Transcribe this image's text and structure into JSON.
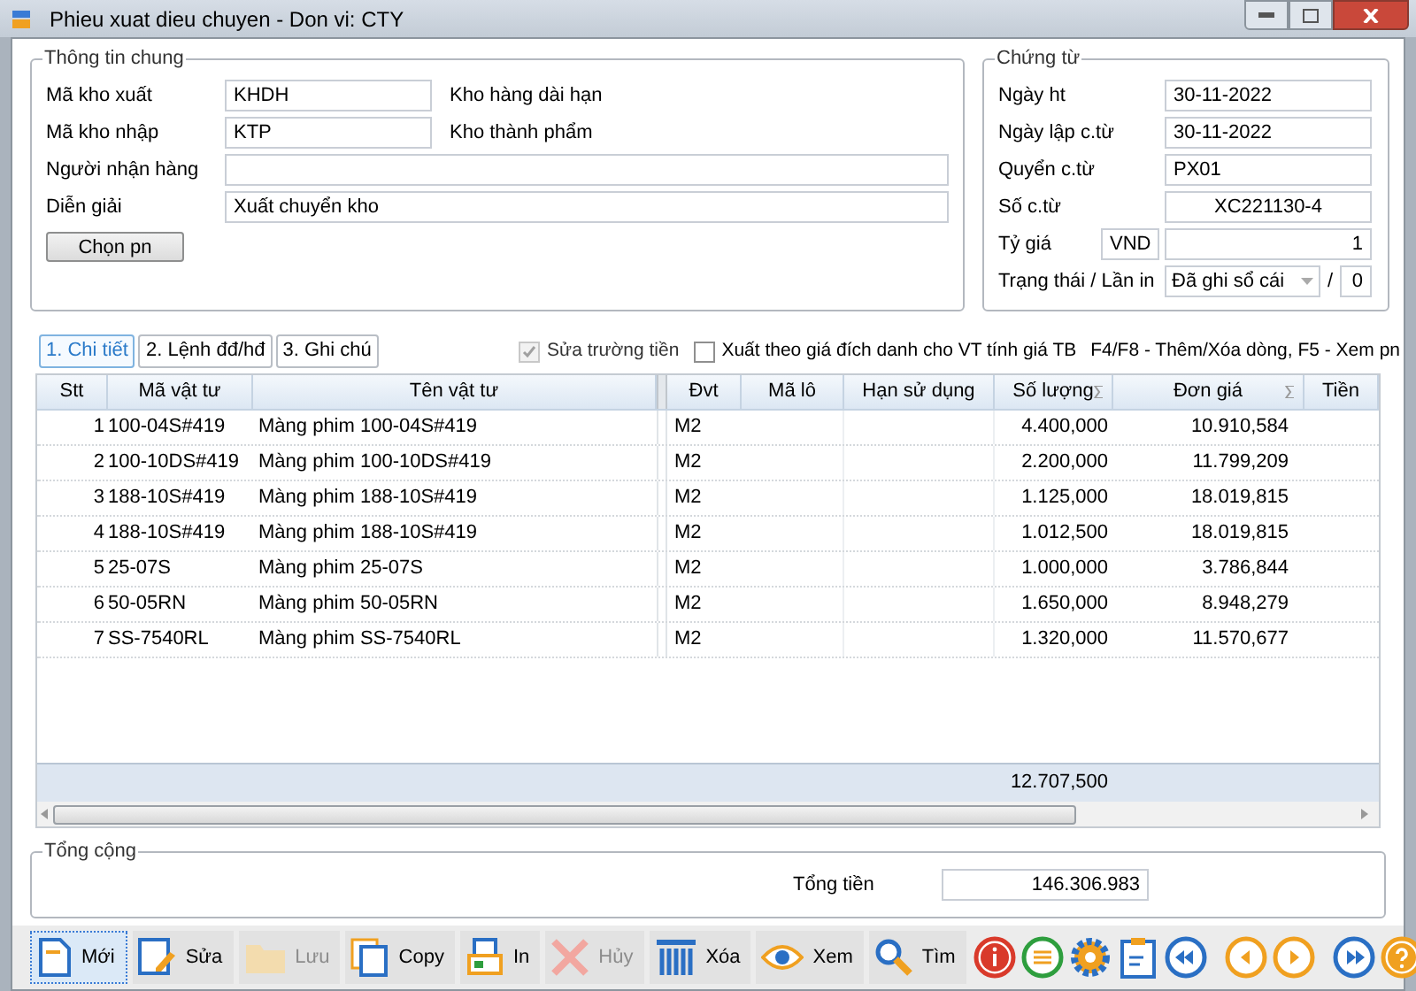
{
  "window": {
    "title": "Phieu xuat dieu chuyen - Don vi: CTY"
  },
  "general": {
    "title": "Thông tin chung",
    "fields": [
      {
        "label": "Mã kho xuất",
        "value": "KHDH",
        "description": "Kho hàng dài hạn"
      },
      {
        "label": "Mã kho nhập",
        "value": "KTP",
        "description": "Kho thành phẩm"
      },
      {
        "label": "Người nhận hàng"
      },
      {
        "label": "Diễn giải",
        "value": "Xuất chuyển kho"
      }
    ],
    "button": "Chọn pn"
  },
  "voucher": {
    "title": "Chứng từ",
    "fields": [
      {
        "kind": "text",
        "label": "Ngày ht",
        "value": "30-11-2022"
      },
      {
        "kind": "text",
        "label": "Ngày lập c.từ",
        "value": "30-11-2022"
      },
      {
        "kind": "text",
        "label": "Quyển c.từ",
        "value": "PX01"
      },
      {
        "kind": "code",
        "label": "Số c.từ",
        "value": "XC221130-4"
      },
      {
        "kind": "rate",
        "label": "Tỷ giá",
        "currency": "VND",
        "value": "1"
      },
      {
        "kind": "status",
        "label": "Trạng thái / Lần in",
        "value": "Đã ghi sổ cái",
        "separator": "/",
        "count": "0"
      }
    ]
  },
  "tabs": [
    {
      "label": "1. Chi tiết",
      "selected": true
    },
    {
      "label": "2. Lệnh đđ/hđ",
      "selected": false
    },
    {
      "label": "3. Ghi chú",
      "selected": false
    }
  ],
  "options": [
    {
      "label": "Sửa trường tiền",
      "checked": true,
      "disabled": true
    },
    {
      "label": "Xuất theo giá đích danh cho VT tính giá TB",
      "checked": false,
      "disabled": false
    }
  ],
  "hint": "F4/F8 - Thêm/Xóa dòng, F5 - Xem pn",
  "table": {
    "columns": [
      {
        "label": "Stt",
        "sum": false
      },
      {
        "label": "Mã vật tư",
        "sum": false
      },
      {
        "label": "Tên vật tư",
        "sum": false
      },
      {
        "label": "Đvt",
        "sum": false
      },
      {
        "label": "Mã lô",
        "sum": false
      },
      {
        "label": "Hạn sử dụng",
        "sum": false
      },
      {
        "label": "Số lượng",
        "sum": true
      },
      {
        "label": "Đơn giá",
        "sum": true
      },
      {
        "label": "Tiền",
        "sum": false
      }
    ],
    "rows": [
      {
        "stt": "1",
        "code": "100-04S#419",
        "name": "Màng phim 100-04S#419",
        "unit": "M2",
        "quantity": "4.400,000",
        "price": "10.910,584"
      },
      {
        "stt": "2",
        "code": "100-10DS#419",
        "name": "Màng phim 100-10DS#419",
        "unit": "M2",
        "quantity": "2.200,000",
        "price": "11.799,209"
      },
      {
        "stt": "3",
        "code": "188-10S#419",
        "name": "Màng phim 188-10S#419",
        "unit": "M2",
        "quantity": "1.125,000",
        "price": "18.019,815"
      },
      {
        "stt": "4",
        "code": "188-10S#419",
        "name": "Màng phim 188-10S#419",
        "unit": "M2",
        "quantity": "1.012,500",
        "price": "18.019,815"
      },
      {
        "stt": "5",
        "code": "25-07S",
        "name": "Màng phim 25-07S",
        "unit": "M2",
        "quantity": "1.000,000",
        "price": "3.786,844"
      },
      {
        "stt": "6",
        "code": "50-05RN",
        "name": "Màng phim 50-05RN",
        "unit": "M2",
        "quantity": "1.650,000",
        "price": "8.948,279"
      },
      {
        "stt": "7",
        "code": "SS-7540RL",
        "name": "Màng phim SS-7540RL",
        "unit": "M2",
        "quantity": "1.320,000",
        "price": "11.570,677"
      }
    ],
    "total_quantity": "12.707,500"
  },
  "summary": {
    "title": "Tổng cộng",
    "label": "Tổng tiền",
    "value": "146.306.983"
  },
  "toolbar": [
    {
      "label": "Mới",
      "selected": true,
      "disabled": false
    },
    {
      "label": "Sửa",
      "selected": false,
      "disabled": false
    },
    {
      "label": "Lưu",
      "selected": false,
      "disabled": true
    },
    {
      "label": "Copy",
      "selected": false,
      "disabled": false
    },
    {
      "label": "In",
      "selected": false,
      "disabled": false
    },
    {
      "label": "Hủy",
      "selected": false,
      "disabled": true
    },
    {
      "label": "Xóa",
      "selected": false,
      "disabled": false
    },
    {
      "label": "Xem",
      "selected": false,
      "disabled": false
    },
    {
      "label": "Tìm",
      "selected": false,
      "disabled": false
    }
  ]
}
